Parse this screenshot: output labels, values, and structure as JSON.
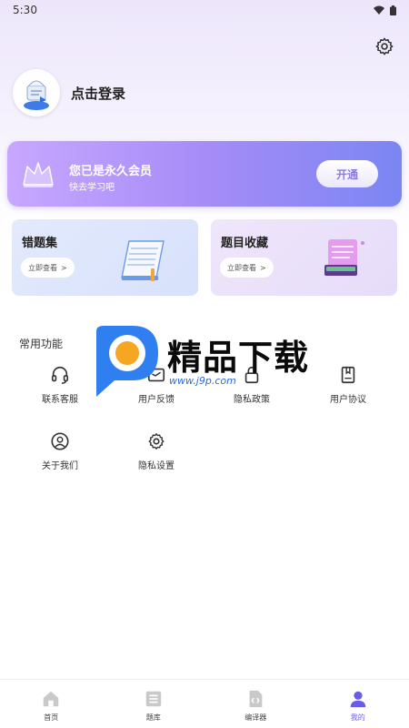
{
  "status_bar": {
    "time": "5:30"
  },
  "profile": {
    "login_label": "点击登录"
  },
  "vip": {
    "title": "您已是永久会员",
    "subtitle": "快去学习吧",
    "button_label": "开通"
  },
  "cards": {
    "wrong": {
      "title": "错题集",
      "button_label": "立即查看",
      "arrow": ">"
    },
    "favorites": {
      "title": "题目收藏",
      "button_label": "立即查看",
      "arrow": ">"
    }
  },
  "functions": {
    "section_title": "常用功能",
    "items": [
      {
        "label": "联系客服",
        "icon": "headset-icon"
      },
      {
        "label": "用户反馈",
        "icon": "feedback-icon"
      },
      {
        "label": "隐私政策",
        "icon": "lock-icon"
      },
      {
        "label": "用户协议",
        "icon": "book-icon"
      },
      {
        "label": "关于我们",
        "icon": "person-circle-icon"
      },
      {
        "label": "隐私设置",
        "icon": "gear-icon"
      }
    ]
  },
  "watermark": {
    "text": "精品下载",
    "url": "www.j9p.com"
  },
  "bottom_nav": {
    "items": [
      {
        "label": "首页",
        "icon": "home-icon"
      },
      {
        "label": "题库",
        "icon": "list-icon"
      },
      {
        "label": "编译器",
        "icon": "code-file-icon"
      },
      {
        "label": "我的",
        "icon": "user-icon"
      }
    ],
    "active_index": 3
  },
  "colors": {
    "accent": "#6b5ce6",
    "vip_start": "#c7a7ff",
    "vip_end": "#7b86f3"
  }
}
